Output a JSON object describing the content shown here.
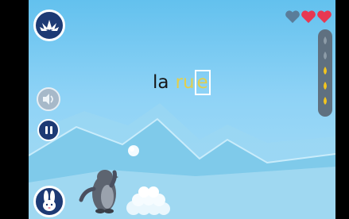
{
  "word": {
    "part_plain": "la",
    "part_highlight": "ru",
    "part_current": "e"
  },
  "lives": {
    "total": 3,
    "remaining": 2
  },
  "progress": {
    "total": 5,
    "completed": 3
  },
  "colors": {
    "sky_top": "#63c1ee",
    "heart_full": "#e73852",
    "heart_empty": "#5a7d9a",
    "highlight_letter": "#e2cf4c",
    "button_dark": "#1d3a74",
    "progress_track": "#5f7080",
    "progress_done": "#f2c51f",
    "progress_todo": "#8d9ca8"
  },
  "icons": {
    "top_left": "lotus-icon",
    "sound": "speaker-icon",
    "pause": "pause-icon",
    "bottom_left": "rabbit-icon"
  }
}
